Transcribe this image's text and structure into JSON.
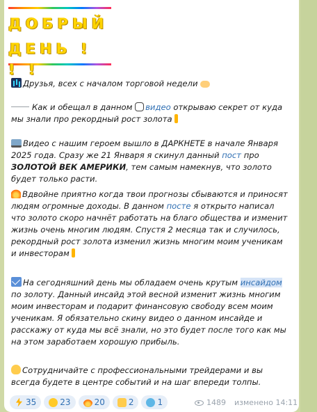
{
  "header": {
    "line1": "ДОБРЫЙ",
    "line2": "ДЕНЬ ! ! !"
  },
  "post": {
    "p1": "Друзья, всех с началом торговой недели",
    "p2_a": "Как и обещал в данном",
    "p2_link": "видео",
    "p2_b": "открываю секрет от куда мы знали про рекордный рост золота",
    "p3_a": "Видео с нашим героем вышло в ДАРКНЕТЕ в начале Января 2025 года.  Сразу же 21 Января я скинул данный",
    "p3_link": "пост",
    "p3_b": "про",
    "p3_bold": "ЗОЛОТОЙ ВЕК АМЕРИКИ",
    "p3_c": ", тем самым намекнув, что золото будет только расти.",
    "p4_a": "Вдвойне приятно когда твои прогнозы сбываются и приносят людям огромные доходы. В данном",
    "p4_link": "посте",
    "p4_b": "я открыто написал что золото скоро начнёт работать на благо общества и изменит жизнь очень многим людям. Спустя 2 месяца так и случилось, рекордный рост золота изменил жизнь многим моим ученикам и инвесторам",
    "p5_a": "На сегодняшний день мы обладаем очень крутым",
    "p5_link": "инсайдом",
    "p5_b": "по золоту. Данный инсайд этой весной изменит жизнь многим моим инвесторам и подарит финансовую свободу всем моим ученикам. Я обязательно скину видео о данном инсайде и расскажу от куда мы всё знали, но это будет после того как мы на этом заработаем хорошую прибыль.",
    "p6": "Сотрудничайте с профессиональными трейдерами и вы всегда будете в центре событий и на шаг впереди толпы."
  },
  "reactions": [
    {
      "icon": "lightning-icon",
      "count": "35"
    },
    {
      "icon": "kiss-face-icon",
      "count": "23"
    },
    {
      "icon": "fire-icon",
      "count": "20"
    },
    {
      "icon": "thumbs-up-icon",
      "count": "2"
    },
    {
      "icon": "whale-icon",
      "count": "1"
    }
  ],
  "meta": {
    "views": "1489",
    "edited": "изменено 14:11"
  },
  "colors": {
    "link": "#2f6fb3",
    "title_yellow": "#ffd400",
    "reaction_bg": "#e6eef8"
  }
}
